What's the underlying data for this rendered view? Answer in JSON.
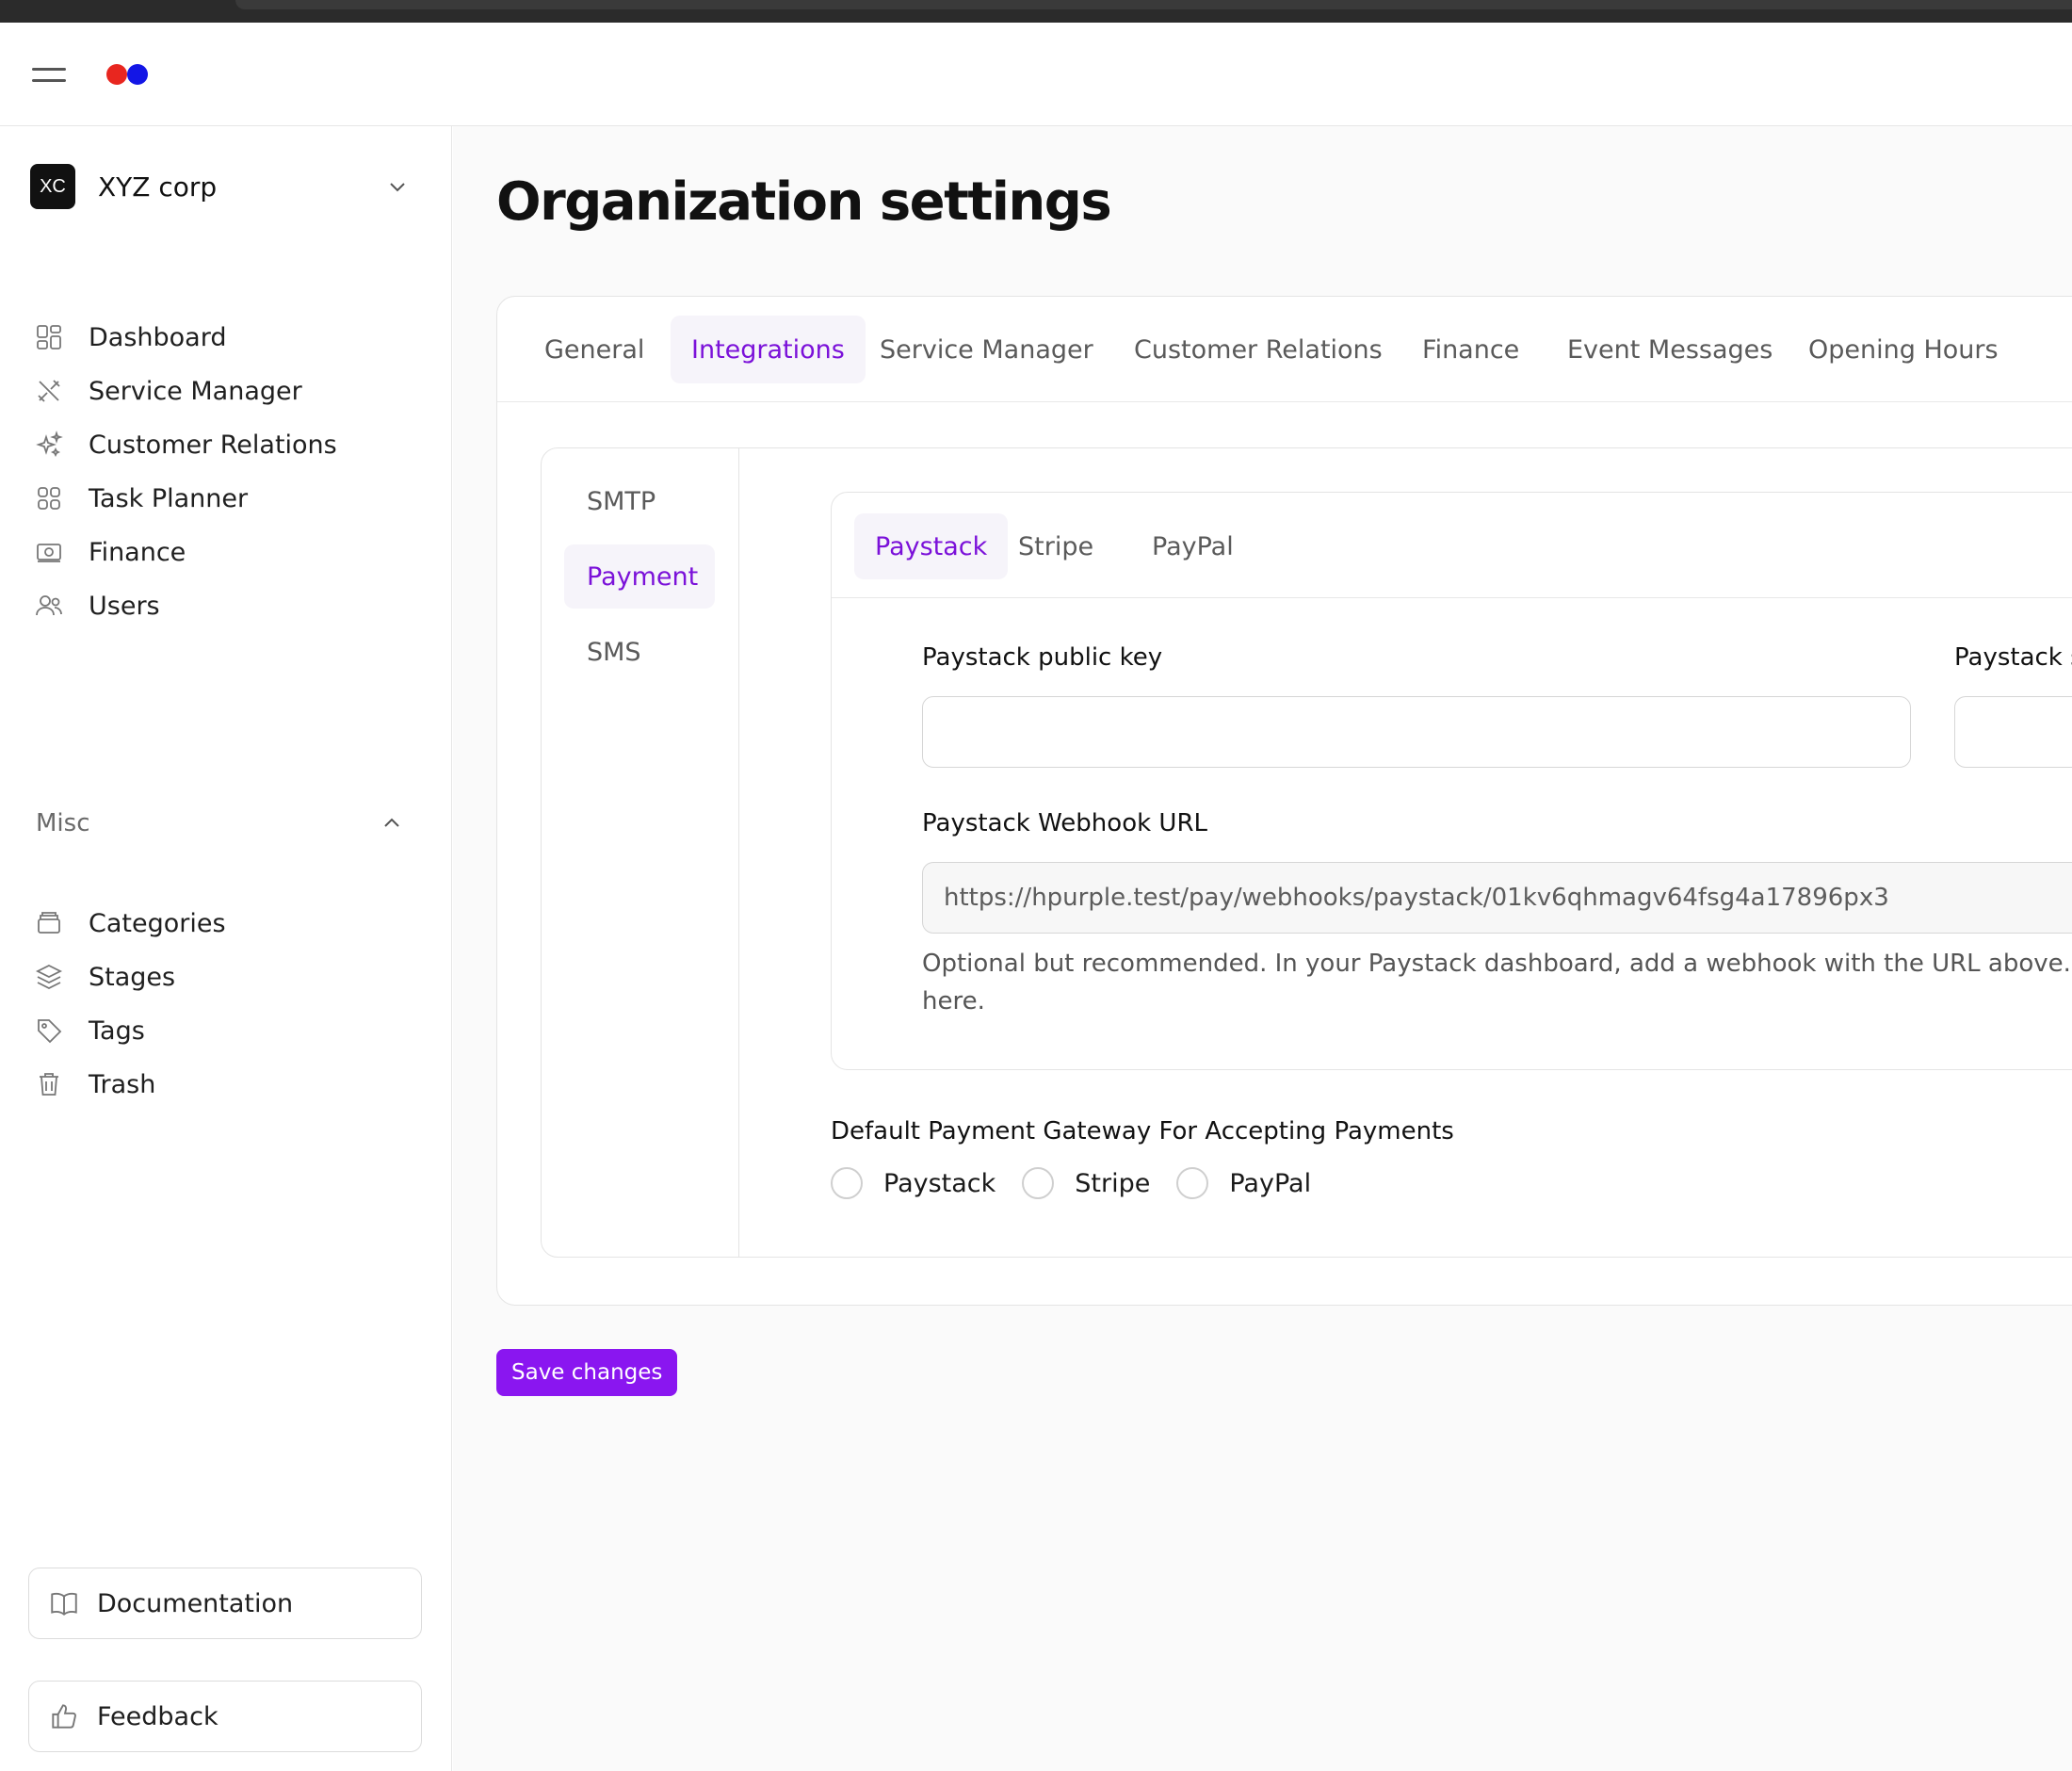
{
  "header": {
    "menu_icon": "hamburger-icon",
    "logo_colors": [
      "#e8261f",
      "#1316e6"
    ]
  },
  "sidebar": {
    "org": {
      "badge": "XC",
      "name": "XYZ corp"
    },
    "items": [
      {
        "label": "Dashboard",
        "icon": "dashboard-icon"
      },
      {
        "label": "Service Manager",
        "icon": "tools-icon"
      },
      {
        "label": "Customer Relations",
        "icon": "sparkles-icon"
      },
      {
        "label": "Task Planner",
        "icon": "grid-icon"
      },
      {
        "label": "Finance",
        "icon": "banknote-icon"
      },
      {
        "label": "Users",
        "icon": "users-icon"
      }
    ],
    "misc_label": "Misc",
    "misc_items": [
      {
        "label": "Categories",
        "icon": "archive-icon"
      },
      {
        "label": "Stages",
        "icon": "layers-icon"
      },
      {
        "label": "Tags",
        "icon": "tag-icon"
      },
      {
        "label": "Trash",
        "icon": "trash-icon"
      }
    ],
    "documentation_label": "Documentation",
    "feedback_label": "Feedback"
  },
  "main": {
    "title": "Organization settings",
    "tabs": [
      "General",
      "Integrations",
      "Service Manager",
      "Customer Relations",
      "Finance",
      "Event Messages",
      "Opening Hours"
    ],
    "active_tab": "Integrations",
    "subnav": [
      "SMTP",
      "Payment",
      "SMS"
    ],
    "active_subnav": "Payment",
    "gateway_tabs": [
      "Paystack",
      "Stripe",
      "PayPal"
    ],
    "active_gateway": "Paystack",
    "public_key_label": "Paystack public key",
    "public_key_value": "",
    "secret_key_label": "Paystack s",
    "webhook_label": "Paystack Webhook URL",
    "webhook_value": "https://hpurple.test/pay/webhooks/paystack/01kv6qhmagv64fsg4a17896px3",
    "help_text_line1": "Optional but recommended. In your Paystack dashboard, add a webhook with the URL above. Pays",
    "help_text_line2": "here.",
    "default_gateway_label": "Default Payment Gateway For Accepting Payments",
    "default_gateway_options": [
      "Paystack",
      "Stripe",
      "PayPal"
    ],
    "save_label": "Save changes"
  },
  "colors": {
    "accent": "#7b11d9",
    "save_button": "#8a16f0",
    "active_tab_bg": "#f6f4fa"
  }
}
